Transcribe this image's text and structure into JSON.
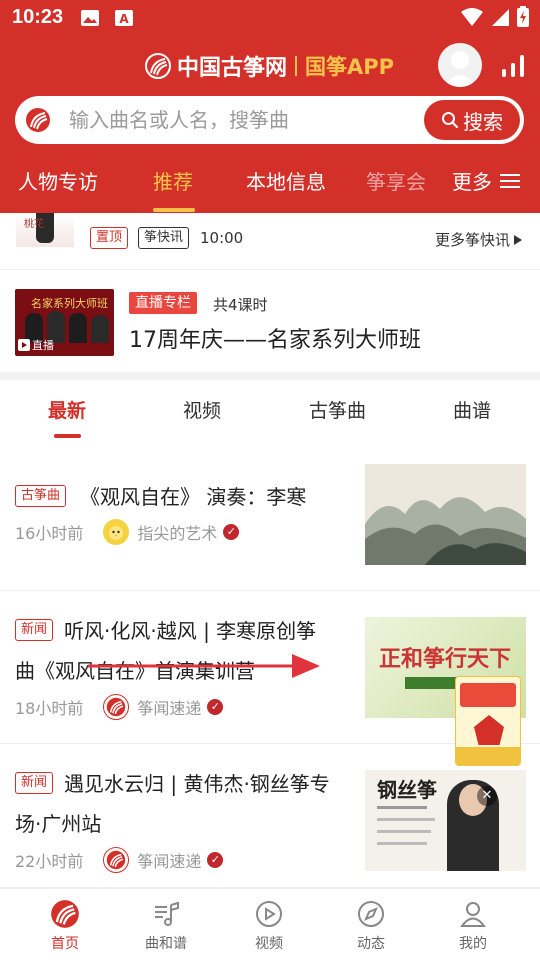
{
  "status_bar": {
    "time": "10:23"
  },
  "header": {
    "brand_name": "中国古筝网",
    "brand_app": "国筝APP",
    "search": {
      "placeholder": "输入曲名或人名，搜筝曲",
      "button_label": "搜索"
    },
    "tabs": [
      {
        "label": "人物专访"
      },
      {
        "label": "推荐",
        "active": true
      },
      {
        "label": "本地信息"
      },
      {
        "label": "筝享会"
      },
      {
        "label": "更多"
      }
    ]
  },
  "news_strip": {
    "tags": [
      "置顶",
      "筝快讯"
    ],
    "time": "10:00",
    "more_label": "更多筝快讯"
  },
  "live": {
    "badge": "直播专栏",
    "lessons": "共4课时",
    "title": "17周年庆——名家系列大师班",
    "thumb_label": "直播",
    "thumb_text": "名家系列大师班"
  },
  "sub_tabs": [
    {
      "label": "最新",
      "active": true
    },
    {
      "label": "视频"
    },
    {
      "label": "古筝曲"
    },
    {
      "label": "曲谱"
    }
  ],
  "articles": [
    {
      "tag": "古筝曲",
      "title": "《观风自在》 演奏：李寒",
      "time": "16小时前",
      "author": "指尖的艺术"
    },
    {
      "tag": "新闻",
      "title_line1": "听风·化风·越风 | 李寒原创筝",
      "title_line2": "曲《观风自在》首演集训营",
      "time": "18小时前",
      "author": "筝闻速递",
      "image_text": "正和筝行天下"
    },
    {
      "tag": "新闻",
      "title_line1": "遇见水云归 | 黄伟杰·钢丝筝专",
      "title_line2": "场·广州站",
      "time": "22小时前",
      "author": "筝闻速递",
      "image_text": "钢丝筝"
    }
  ],
  "bottom_nav": [
    {
      "label": "首页",
      "active": true
    },
    {
      "label": "曲和谱"
    },
    {
      "label": "视频"
    },
    {
      "label": "动态"
    },
    {
      "label": "我的"
    }
  ],
  "colors": {
    "brand_red": "#d4302a",
    "accent_gold": "#f6c24a"
  }
}
